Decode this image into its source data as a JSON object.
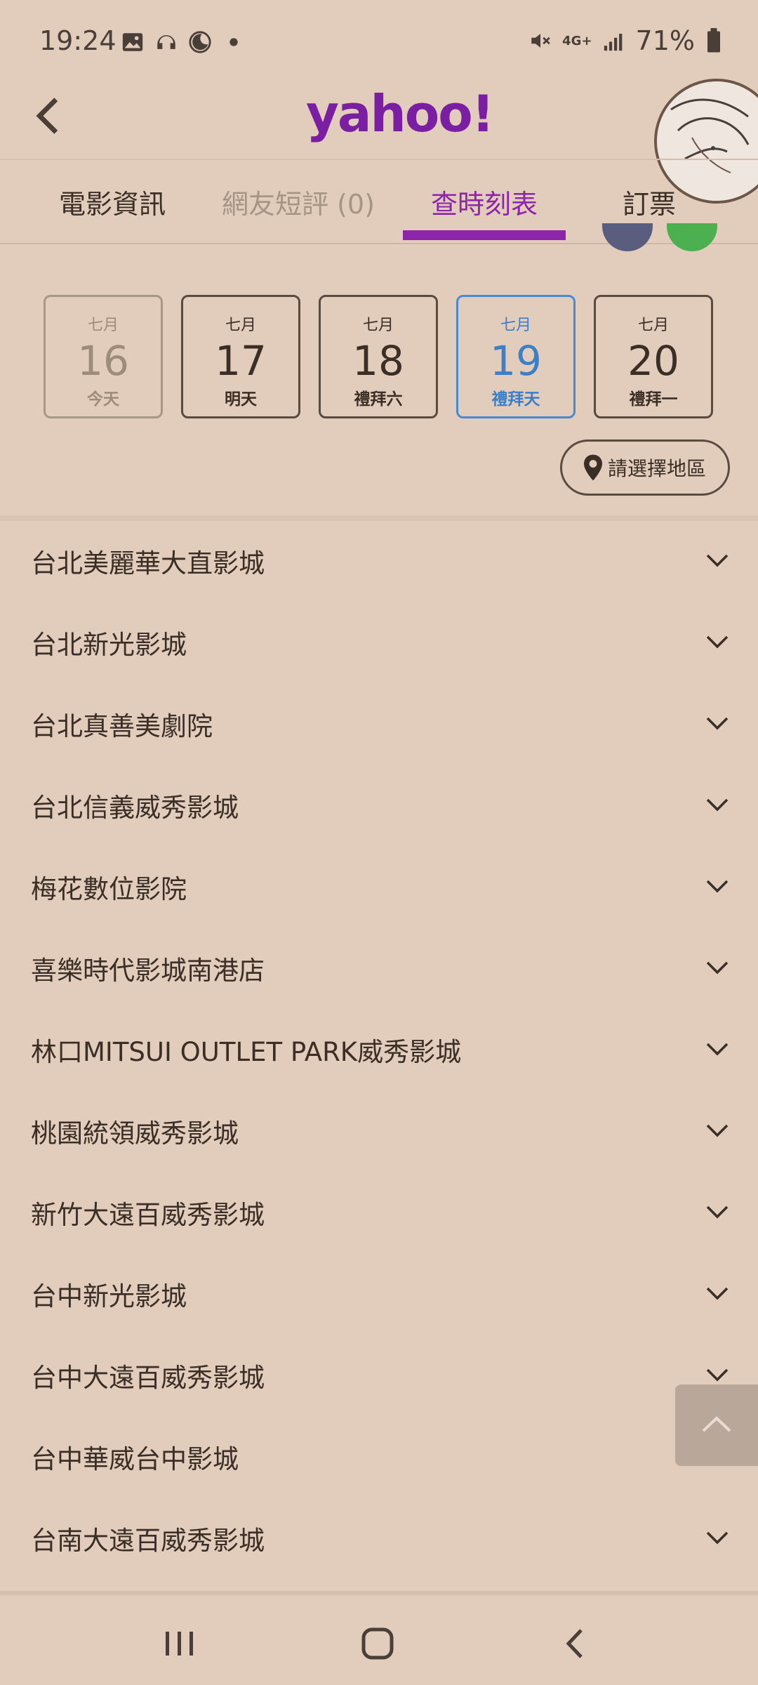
{
  "status_bar": {
    "time": "19:24",
    "left_icons": [
      "image-icon",
      "headset-icon",
      "moon-icon",
      "dot-icon"
    ],
    "network": "4G+",
    "battery": "71%"
  },
  "header": {
    "logo": "yahoo!",
    "accent_color": "#8e24aa"
  },
  "tabs": [
    {
      "label": "電影資訊",
      "state": "normal"
    },
    {
      "label": "網友短評 (0)",
      "state": "disabled"
    },
    {
      "label": "查時刻表",
      "state": "active"
    },
    {
      "label": "訂票",
      "state": "normal"
    }
  ],
  "dates": [
    {
      "month": "七月",
      "day": "16",
      "weekday": "今天",
      "state": "past"
    },
    {
      "month": "七月",
      "day": "17",
      "weekday": "明天",
      "state": "normal"
    },
    {
      "month": "七月",
      "day": "18",
      "weekday": "禮拜六",
      "state": "normal"
    },
    {
      "month": "七月",
      "day": "19",
      "weekday": "禮拜天",
      "state": "selected"
    },
    {
      "month": "七月",
      "day": "20",
      "weekday": "禮拜一",
      "state": "normal"
    }
  ],
  "region_button": {
    "label": "請選擇地區"
  },
  "theaters": [
    "台北美麗華大直影城",
    "台北新光影城",
    "台北真善美劇院",
    "台北信義威秀影城",
    "梅花數位影院",
    "喜樂時代影城南港店",
    "林口MITSUI OUTLET PARK威秀影城",
    "桃園統領威秀影城",
    "新竹大遠百威秀影城",
    "台中新光影城",
    "台中大遠百威秀影城",
    "台中華威台中影城",
    "台南大遠百威秀影城"
  ]
}
